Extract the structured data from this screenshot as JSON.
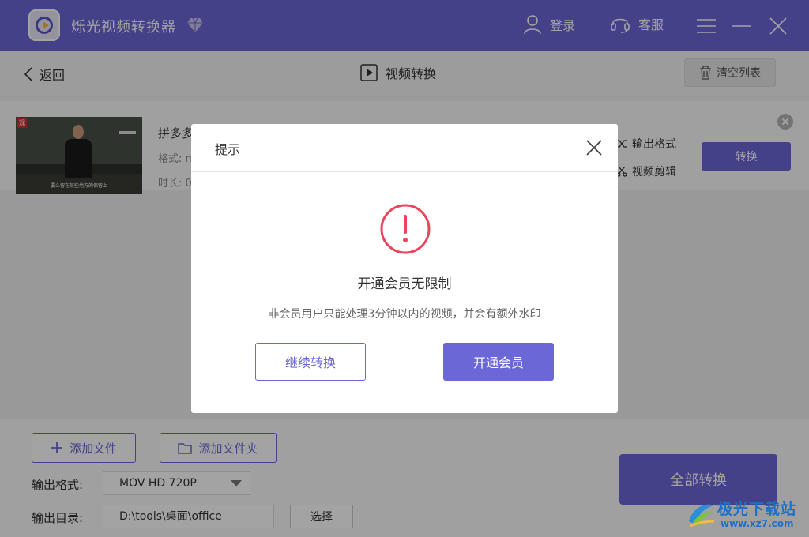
{
  "app": {
    "title": "烁光视频转换器"
  },
  "titlebar": {
    "login": "登录",
    "service": "客服"
  },
  "subbar": {
    "back": "返回",
    "title": "视频转换",
    "clear": "清空列表"
  },
  "file": {
    "name": "拼多多",
    "format_label": "格式: m",
    "duration_label": "时长: 0",
    "thumb_badge": "观",
    "thumb_subtitle": "要么留在某些地方的保留上",
    "option_format": "输出格式",
    "option_edit": "视频剪辑",
    "convert": "转换"
  },
  "bottom": {
    "add_file": "添加文件",
    "add_folder": "添加文件夹",
    "output_format_label": "输出格式:",
    "output_format_value": "MOV HD 720P",
    "output_dir_label": "输出目录:",
    "output_dir_value": "D:\\tools\\桌面\\office",
    "choose": "选择",
    "convert_all": "全部转换"
  },
  "modal": {
    "title": "提示",
    "heading": "开通会员无限制",
    "description": "非会员用户只能处理3分钟以内的视频，并会有额外水印",
    "continue": "继续转换",
    "vip": "开通会员"
  },
  "watermark": {
    "text": "极光下载站",
    "url": "www.xz7.com"
  },
  "colors": {
    "accent": "#6c67d6",
    "warning": "#e8465a"
  }
}
